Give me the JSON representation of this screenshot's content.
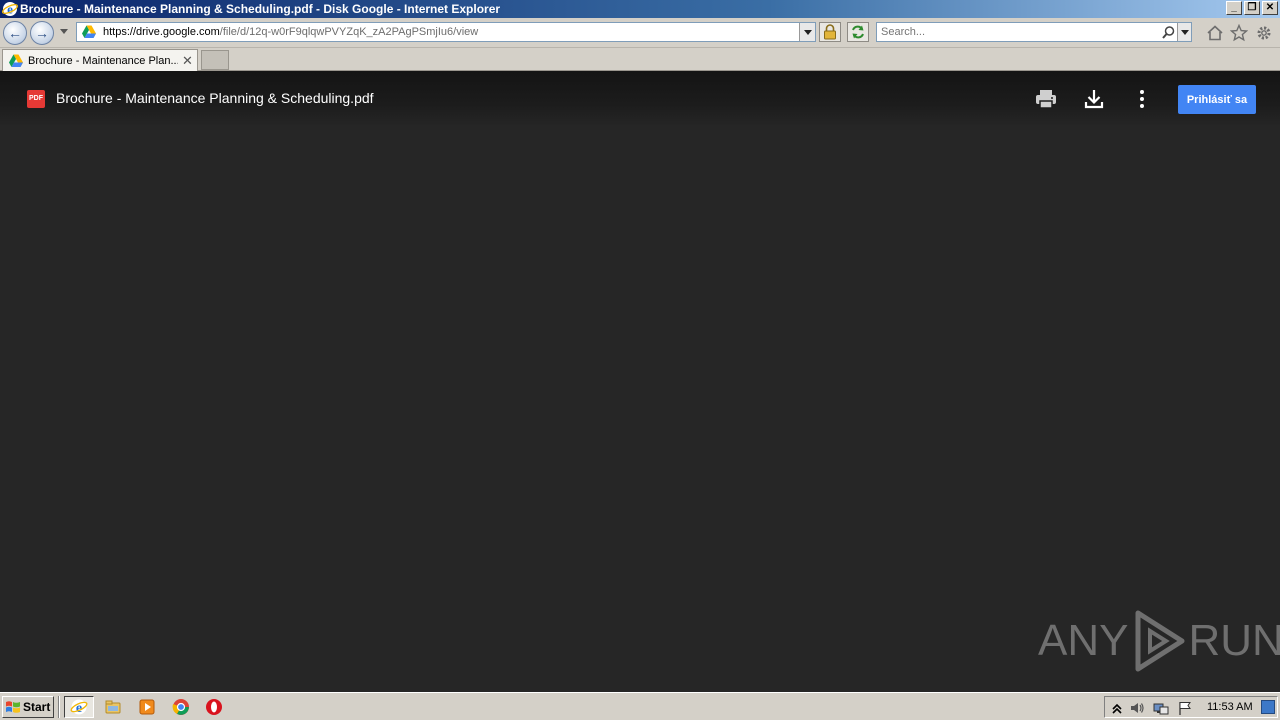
{
  "window": {
    "title": "Brochure - Maintenance Planning & Scheduling.pdf - Disk Google - Internet Explorer",
    "controls": [
      "minimize",
      "restore",
      "close"
    ]
  },
  "addressbar": {
    "url_prefix": "https://drive.",
    "url_domain": "google.com",
    "url_path": "/file/d/12q-w0rF9qlqwPVYZqK_zA2PAgPSmjIu6/view",
    "security": "lock-icon"
  },
  "search": {
    "placeholder": "Search..."
  },
  "tabs": [
    {
      "label": "Brochure - Maintenance Plan...",
      "active": true
    }
  ],
  "viewer": {
    "badge": "PDF",
    "file_title": "Brochure - Maintenance Planning & Scheduling.pdf",
    "signin_label": "Prihlásiť sa",
    "actions": [
      "print-icon",
      "download-icon",
      "more-options-icon"
    ],
    "accent_color": "#4285f4",
    "background_color": "#262626"
  },
  "watermark": {
    "left": "ANY",
    "right": "RUN"
  },
  "taskbar": {
    "start_label": "Start",
    "quicklaunch": [
      "internet-explorer-icon",
      "windows-explorer-icon",
      "media-player-icon",
      "chrome-icon",
      "opera-icon"
    ],
    "tray": [
      "show-hidden-icon",
      "volume-icon",
      "network-icon",
      "action-center-flag-icon"
    ],
    "clock": "11:53 AM"
  }
}
